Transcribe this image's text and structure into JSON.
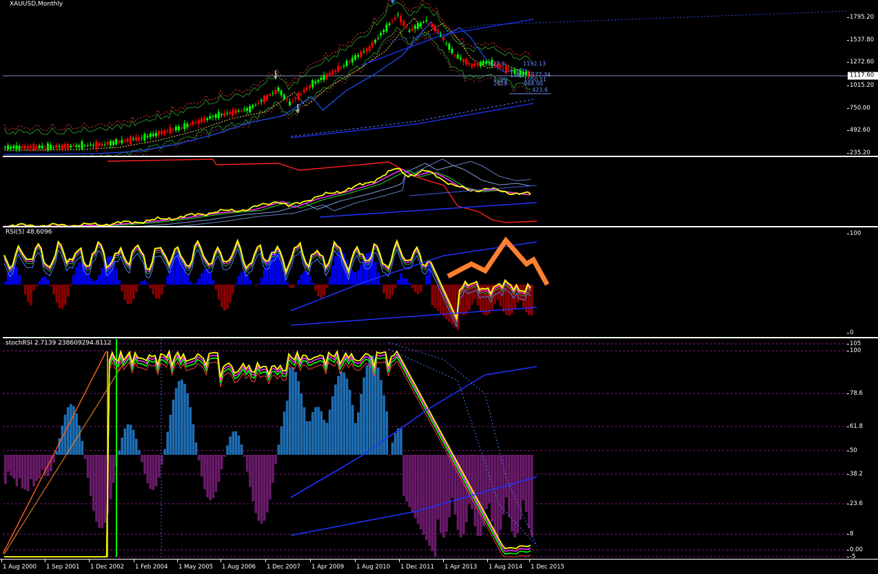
{
  "chart": {
    "symbol_title": "XAUUSD,Monthly",
    "current_price": "1117.60",
    "level_labels": [
      "423.6",
      "1192.13",
      "1382",
      "1177.34",
      "1200",
      "1050.51",
      "2618",
      "968.00",
      "423.6"
    ]
  },
  "panes": {
    "main": {
      "price_ticks": [
        "1795.20",
        "1537.80",
        "1272.60",
        "1015.20",
        "750.00",
        "492.60",
        "235.20"
      ]
    },
    "rsi": {
      "title": "RSI(5) 48.6096",
      "ticks": [
        "100",
        "0"
      ]
    },
    "stoch": {
      "title": "stochRSI 2.7139 238609294.8112",
      "ticks": [
        "105",
        "100",
        "78.6",
        "61.8",
        "50",
        "38.2",
        "23.6",
        "8",
        "0.00",
        "-5"
      ]
    }
  },
  "time_axis": [
    "1 Aug 2000",
    "1 Sep 2001",
    "1 Dec 2002",
    "1 Feb 2004",
    "1 May 2005",
    "1 Aug 2006",
    "1 Dec 2007",
    "1 Apr 2009",
    "1 Aug 2010",
    "1 Dec 2011",
    "1 Apr 2013",
    "1 Aug 2014",
    "1 Dec 2015"
  ],
  "colors": {
    "background": "#000000",
    "bull_candle": "#00ff00",
    "bear_candle": "#ff0000",
    "rsi_line": "#ffff00",
    "histogram_up": "#0000ff",
    "histogram_down": "#8b0000",
    "stoch_up": "#1e6eb4",
    "stoch_down": "#6a1a6a",
    "trend_blue": "#1e32ff",
    "annotation_orange": "#ff8030"
  }
}
